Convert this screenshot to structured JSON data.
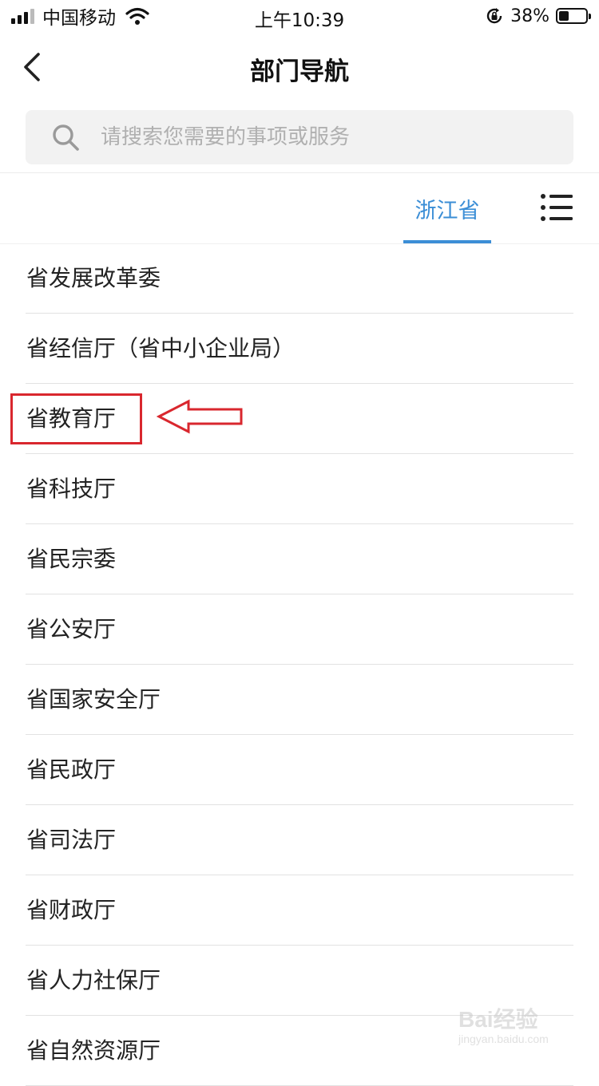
{
  "status_bar": {
    "carrier": "中国移动",
    "time": "上午10:39",
    "battery": "38%",
    "battery_level": 0.38
  },
  "nav": {
    "title": "部门导航",
    "back_icon": "chevron-left-icon"
  },
  "search": {
    "placeholder": "请搜索您需要的事项或服务",
    "icon": "search-icon"
  },
  "tabs": {
    "active": "浙江省",
    "menu_icon": "list-menu-icon",
    "accent_color": "#3b8ed6"
  },
  "departments": [
    "省发展改革委",
    "省经信厅（省中小企业局）",
    "省教育厅",
    "省科技厅",
    "省民宗委",
    "省公安厅",
    "省国家安全厅",
    "省民政厅",
    "省司法厅",
    "省财政厅",
    "省人力社保厅",
    "省自然资源厅"
  ],
  "annotation": {
    "highlighted_item": "省教育厅",
    "color": "#d9272e"
  },
  "watermark": {
    "brand": "Bai经验",
    "url": "jingyan.baidu.com"
  }
}
